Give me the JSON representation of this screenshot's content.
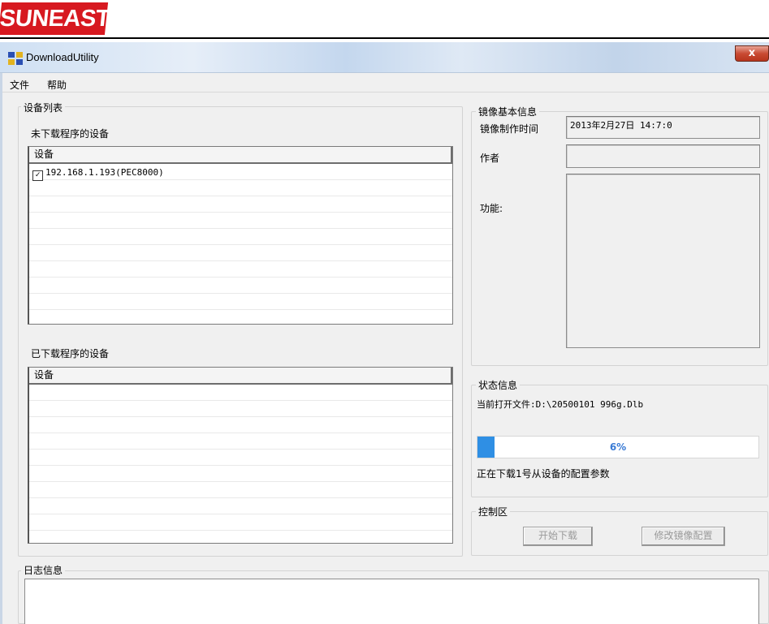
{
  "window": {
    "title": "DownloadUtility",
    "close_label": "x"
  },
  "menu": {
    "file": "文件",
    "help": "帮助"
  },
  "device_list": {
    "title": "设备列表",
    "pending_label": "未下载程序的设备",
    "pending_header": "设备",
    "pending_items": [
      {
        "label": "192.168.1.193(PEC8000)",
        "checked": true
      }
    ],
    "done_label": "已下载程序的设备",
    "done_header": "设备"
  },
  "image_info": {
    "title": "镜像基本信息",
    "time_label": "镜像制作时间",
    "time_value": "2013年2月27日 14:7:0",
    "author_label": "作者",
    "author_value": "",
    "function_label": "功能:",
    "function_value": ""
  },
  "status": {
    "title": "状态信息",
    "current_file": "当前打开文件:D:\\20500101 996g.Dlb",
    "progress": 6,
    "progress_label": "6%",
    "message": "正在下载1号从设备的配置参数"
  },
  "control": {
    "title": "控制区",
    "start_label": "开始下载",
    "modify_label": "修改镜像配置"
  },
  "log": {
    "title": "日志信息"
  },
  "logo": {
    "text": "SUNEAST"
  },
  "colors": {
    "progress": "#2f8fe4",
    "logo": "#d71920"
  }
}
